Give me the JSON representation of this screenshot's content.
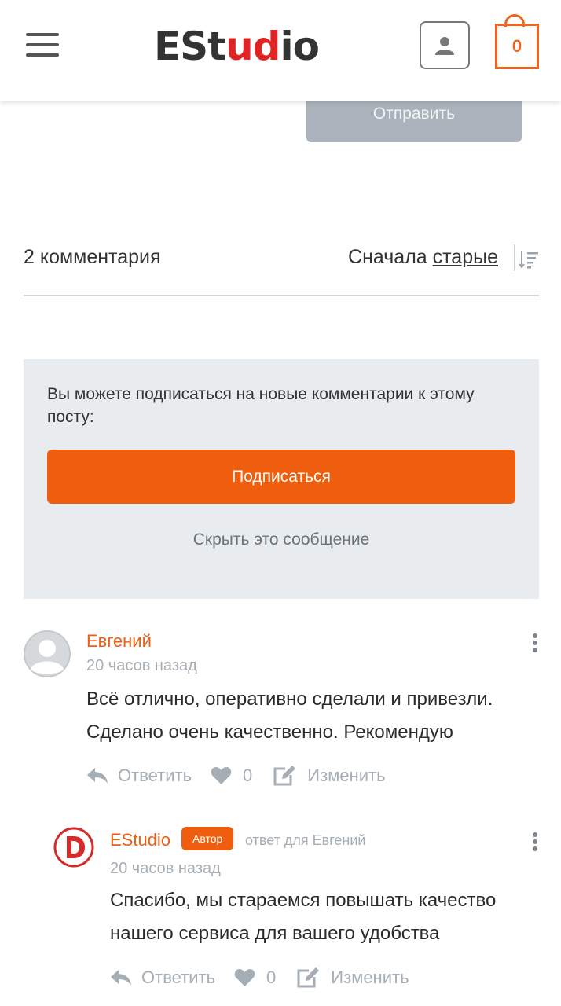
{
  "header": {
    "logo_text": "EStudio",
    "logo_part1": "ESt",
    "logo_part2": "ud",
    "logo_part3": "io",
    "cart_count": "0",
    "accent_color": "#ee5e0e"
  },
  "form": {
    "send_label": "Отправить"
  },
  "comments_header": {
    "count_label": "2 комментария",
    "sort_prefix": "Сначала",
    "sort_value": "старые"
  },
  "subscribe": {
    "text": "Вы можете подписаться на новые комментарии к этому посту:",
    "button_label": "Подписаться",
    "hide_label": "Скрыть это сообщение"
  },
  "comments": [
    {
      "author": "Евгений",
      "time": "20 часов назад",
      "text_line1": "Всё отлично, оперативно сделали и привезли.",
      "text_line2": "Сделано очень качественно. Рекомендую",
      "reply_label": "Ответить",
      "likes": "0",
      "edit_label": "Изменить"
    },
    {
      "author": "EStudio",
      "badge": "Автор",
      "reply_to": "ответ для Евгений",
      "time": "20 часов назад",
      "text_line1": "Спасибо, мы стараемся повышать качество",
      "text_line2": "нашего сервиса для вашего удобства",
      "reply_label": "Ответить",
      "likes": "0",
      "edit_label": "Изменить"
    }
  ]
}
